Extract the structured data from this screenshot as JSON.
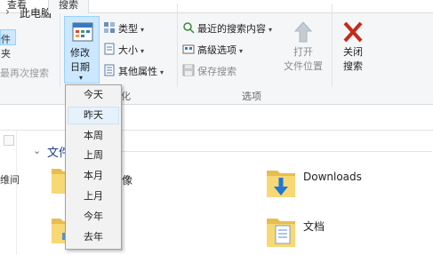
{
  "tabs": [
    {
      "label": "查看"
    },
    {
      "label": "搜索",
      "selected": true
    }
  ],
  "left_partial": {
    "select_all_partial": "件夹",
    "recent_search_partial": "最再次搜索"
  },
  "ribbon": {
    "refine": {
      "modify_date": {
        "line1": "修改",
        "line2": "日期"
      },
      "type_label": "类型",
      "size_label": "大小",
      "other_props_label": "其他属性",
      "group_label_partial": "化"
    },
    "options": {
      "recent_searches": "最近的搜索内容",
      "advanced_options": "高级选项",
      "save_search": "保存搜索",
      "open_location": {
        "line1": "打开",
        "line2": "文件位置"
      },
      "group_label": "选项"
    },
    "close_search": {
      "line1": "关闭",
      "line2": "搜索"
    }
  },
  "breadcrumb": {
    "separator": "›",
    "this_pc": "此电脑"
  },
  "content": {
    "group_header_partial": "文件",
    "nav_partial": "维间",
    "items": [
      {
        "label": "Downloads",
        "icon": "downloads-folder-icon"
      },
      {
        "label": "文档",
        "icon": "documents-folder-icon"
      }
    ]
  },
  "date_dropdown": {
    "items": [
      "今天",
      "昨天",
      "本周",
      "上周",
      "本月",
      "上月",
      "今年",
      "去年"
    ],
    "hovered_index": 1
  },
  "colors": {
    "pressed_bg": "#cce8ff",
    "pressed_border": "#99d1ff",
    "ribbon_bg": "#f5f6f7",
    "close_red": "#c42b1c",
    "folder_yellow": "#f8d775",
    "accent_blue": "#1e78d4"
  }
}
